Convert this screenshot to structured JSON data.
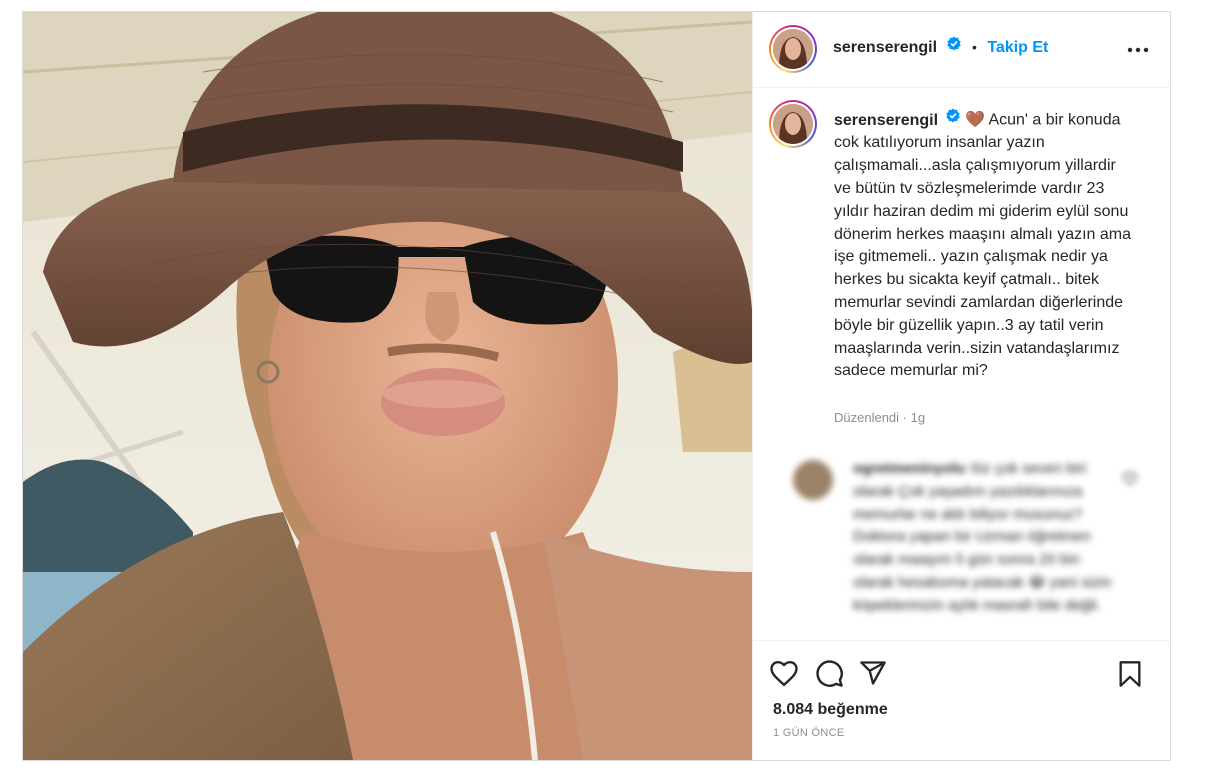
{
  "post": {
    "username": "serenserengil",
    "follow_label": "Takip Et",
    "separator": "•",
    "caption_emoji": "🤎",
    "caption_text": "Acun' a bir konuda cok katılıyorum insanlar yazın çalışmamali...asla çalışmıyorum yillardir ve bütün tv sözleşmelerimde vardır 23 yıldır haziran dedim mi giderim eylül sonu dönerim herkes maaşını almalı yazın ama işe gitmemeli.. yazın çalışmak nedir ya herkes bu sicakta keyif çatmalı.. bitek memurlar sevindi zamlardan diğerlerinde böyle bir güzellik yapın..3 ay tatil verin maaşlarında verin..sizin vatandaşlarımız sadece memurlar mi?",
    "edited_label": "Düzenlendi",
    "edited_dot": "·",
    "edited_age": "1g",
    "comment": {
      "username": "ogretmeninyolu",
      "text": "Siz çok seven biri olarak Çok yaşadım yazdıklarınıza memurlar ne aldı biliyor musunuz? Doktora yapan bir Uzman öğretmen olarak maaşım 5 gün sonra 20 bin olarak hesaboma yatacak 😂 yani sizin köpeklerinizin aylık masrafı bile değil."
    },
    "likes": "8.084 beğenme",
    "time_ago": "1 GÜN ÖNCE"
  },
  "icons": {
    "verified": "verified-badge-icon",
    "more": "more-options-icon",
    "like": "heart-icon",
    "comment": "comment-icon",
    "share": "send-icon",
    "save": "bookmark-icon"
  },
  "colors": {
    "accent": "#0095f6",
    "text": "#262626",
    "muted": "#8e8e8e",
    "border": "#dbdbdb"
  }
}
